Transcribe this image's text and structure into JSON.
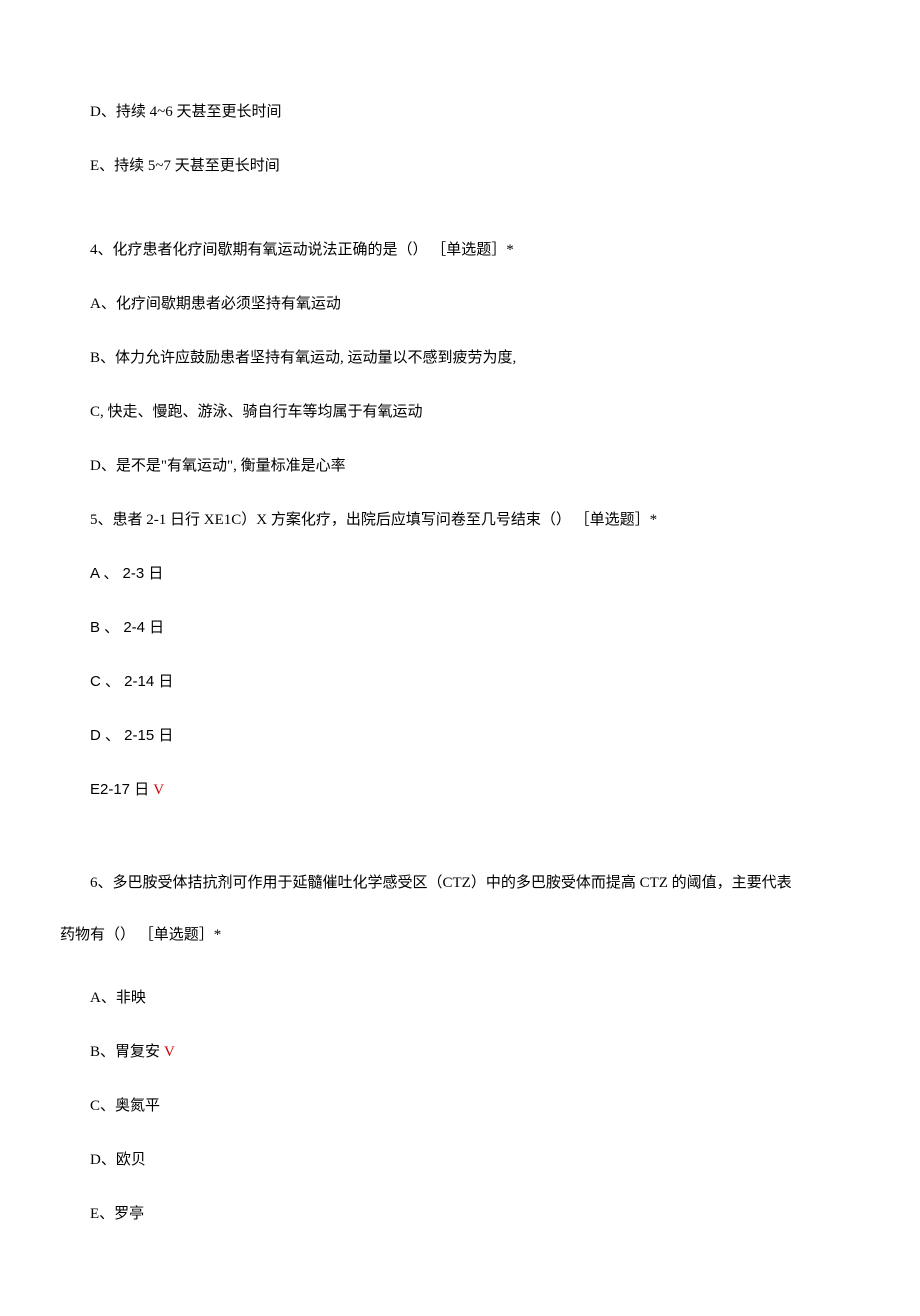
{
  "lines": {
    "optD_prev": "D、持续 4~6 天甚至更长时间",
    "optE_prev": "E、持续 5~7 天甚至更长时间"
  },
  "q4": {
    "stem": "4、化疗患者化疗间歇期有氧运动说法正确的是（） ［单选题］*",
    "a": "A、化疗间歇期患者必须坚持有氧运动",
    "b": "B、体力允许应鼓励患者坚持有氧运动, 运动量以不感到疲劳为度,",
    "c": "C, 快走、慢跑、游泳、骑自行车等均属于有氧运动",
    "d": "D、是不是\"有氧运动\",   衡量标准是心率"
  },
  "q5": {
    "stem": "5、患者 2-1 日行 XE1C）X 方案化疗，出院后应填写问卷至几号结束（） ［单选题］*",
    "a": "A 、 2-3 日",
    "b": "B 、 2-4 日",
    "c": "C 、 2-14 日",
    "d": "D 、 2-15 日",
    "e": "E2-17 日",
    "e_check": "V"
  },
  "q6": {
    "stem_p1": "6、多巴胺受体拮抗剂可作用于延髓催吐化学感受区（CTZ）中的多巴胺受体而提高 CTZ 的阈值，主要代表",
    "stem_p2": "药物有（） ［单选题］*",
    "a": "A、非映",
    "b": "B、胃复安",
    "b_check": "V",
    "c": "C、奥氮平",
    "d": "D、欧贝",
    "e": "E、罗亭"
  }
}
